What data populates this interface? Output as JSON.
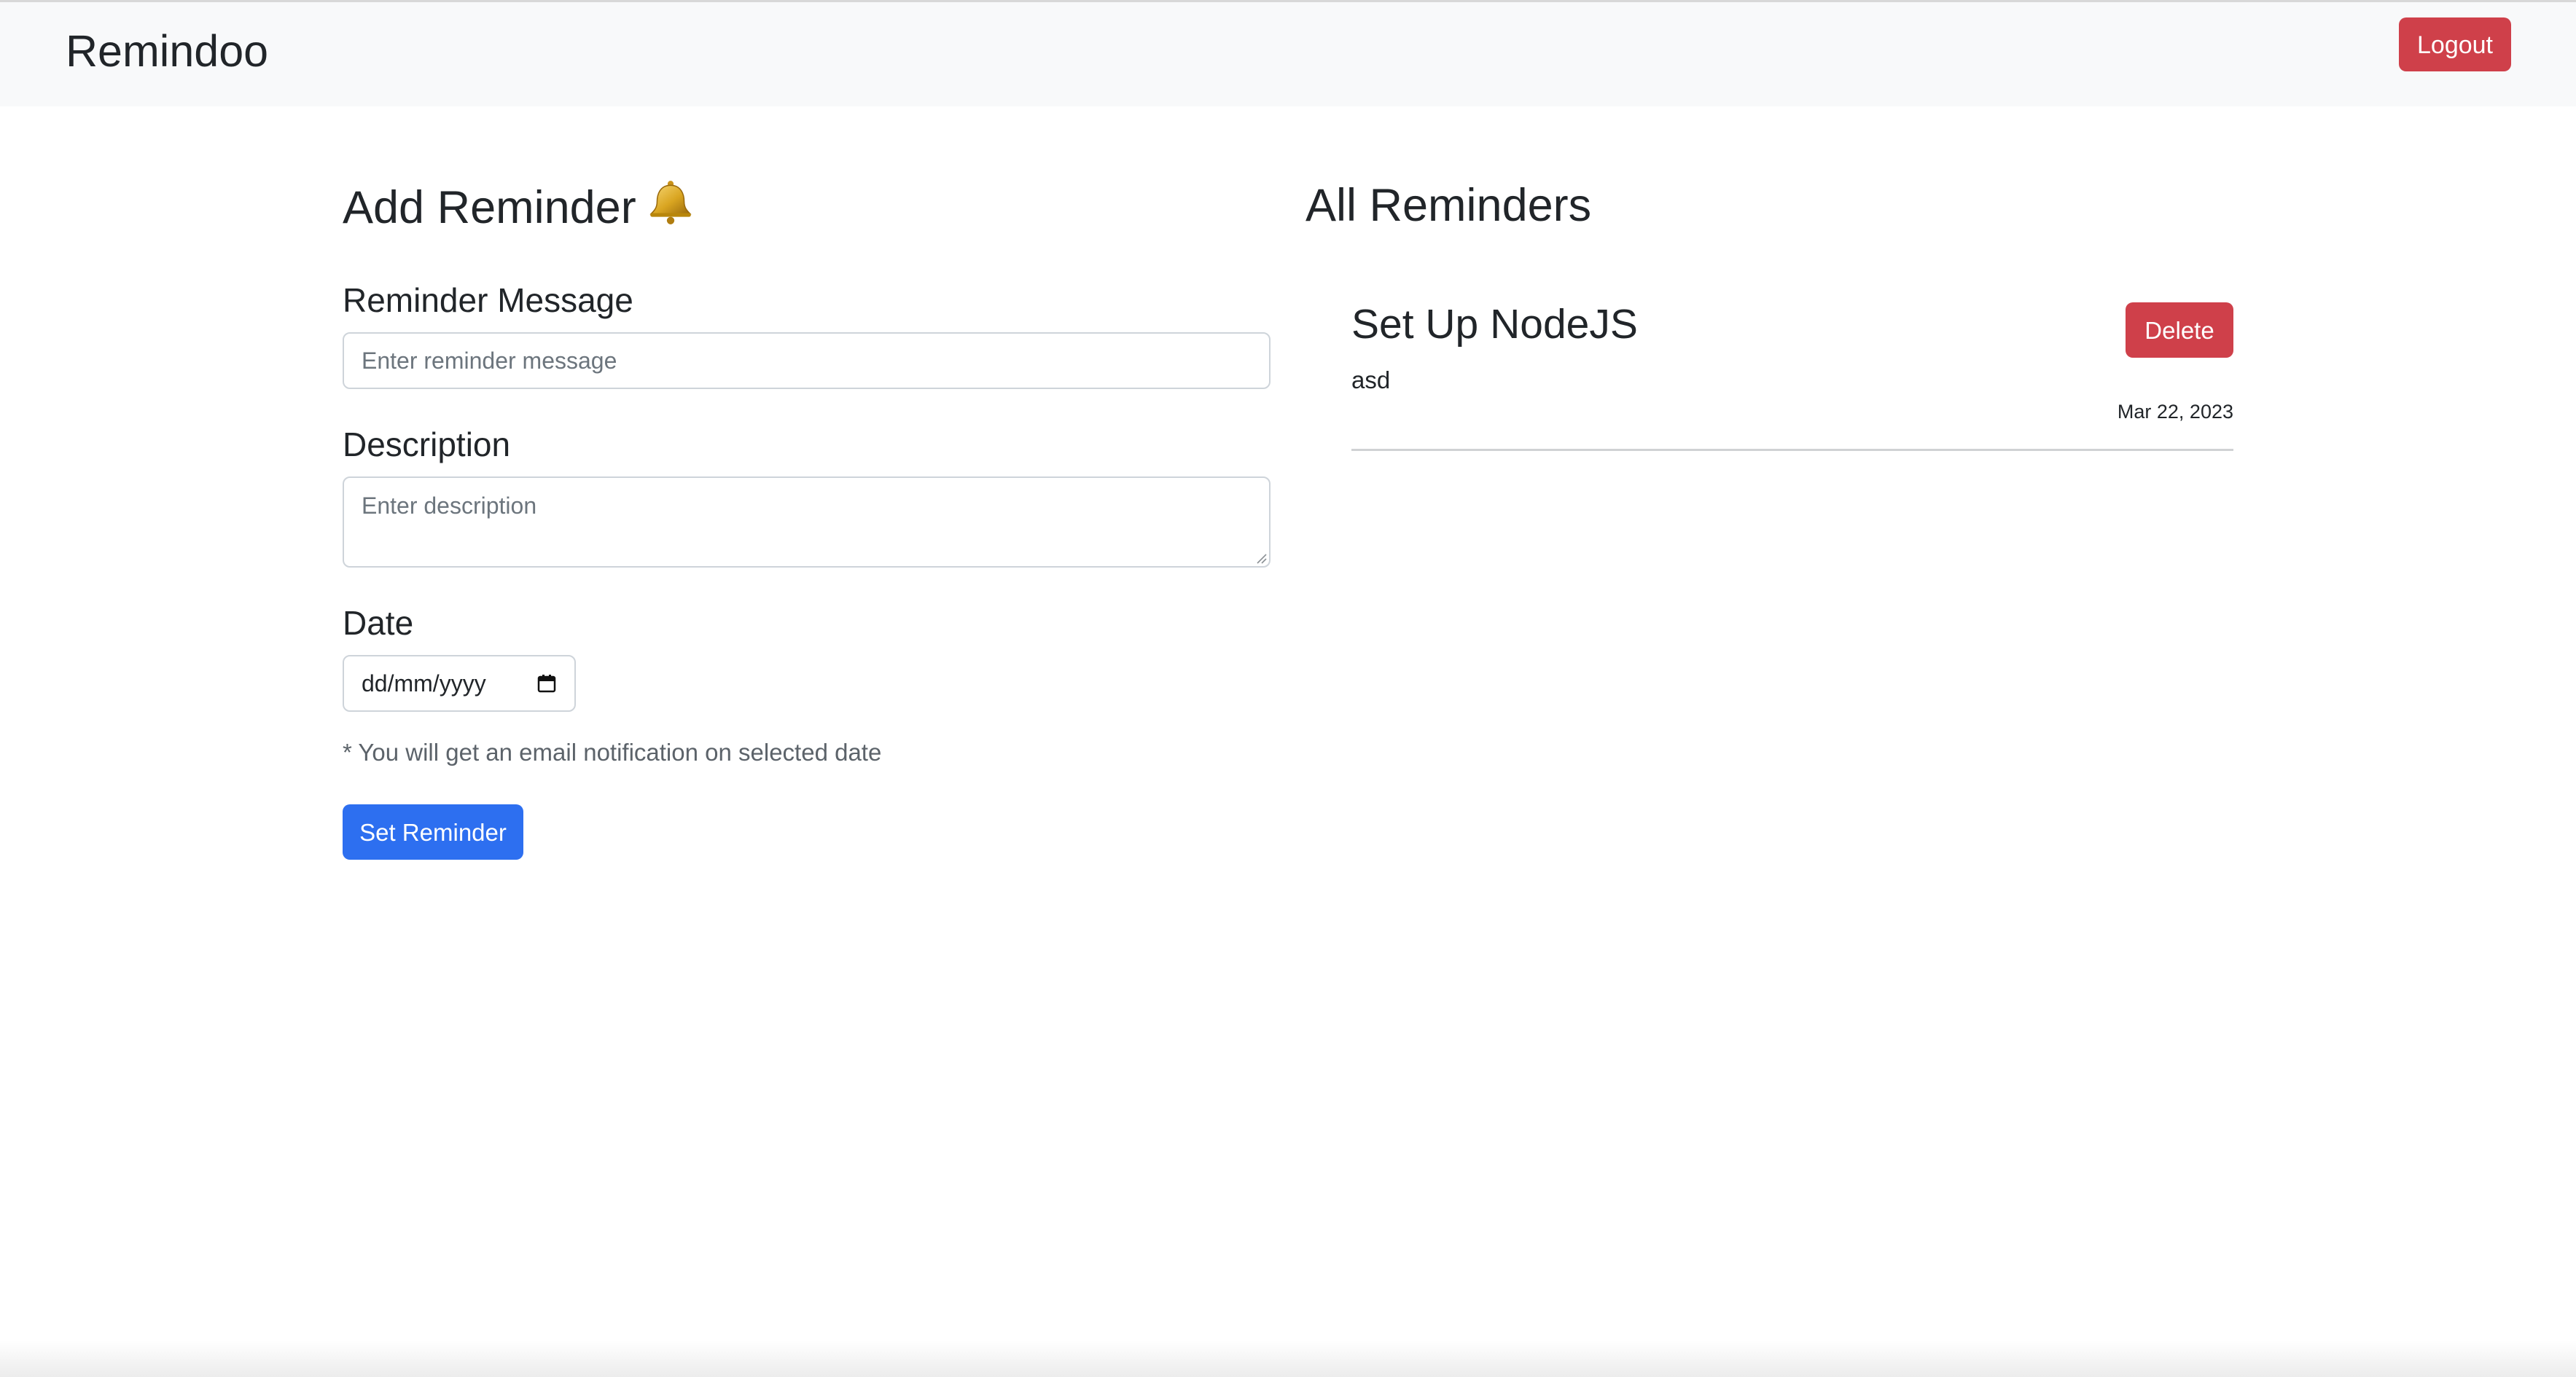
{
  "navbar": {
    "brand": "Remindoo",
    "logout_label": "Logout"
  },
  "add_form": {
    "title": "Add Reminder",
    "title_icon": "bell-icon",
    "message_label": "Reminder Message",
    "message_placeholder": "Enter reminder message",
    "message_value": "",
    "description_label": "Description",
    "description_placeholder": "Enter description",
    "description_value": "",
    "date_label": "Date",
    "date_placeholder": "dd/mm/yyyy",
    "hint": "* You will get an email notification on selected date",
    "submit_label": "Set Reminder"
  },
  "reminders": {
    "title": "All Reminders",
    "items": [
      {
        "title": "Set Up NodeJS",
        "description": "asd",
        "date": "Mar 22, 2023",
        "delete_label": "Delete"
      }
    ]
  },
  "colors": {
    "danger": "#cf404a",
    "primary": "#2d6ff0",
    "navbar_bg": "#f8f9fa"
  }
}
